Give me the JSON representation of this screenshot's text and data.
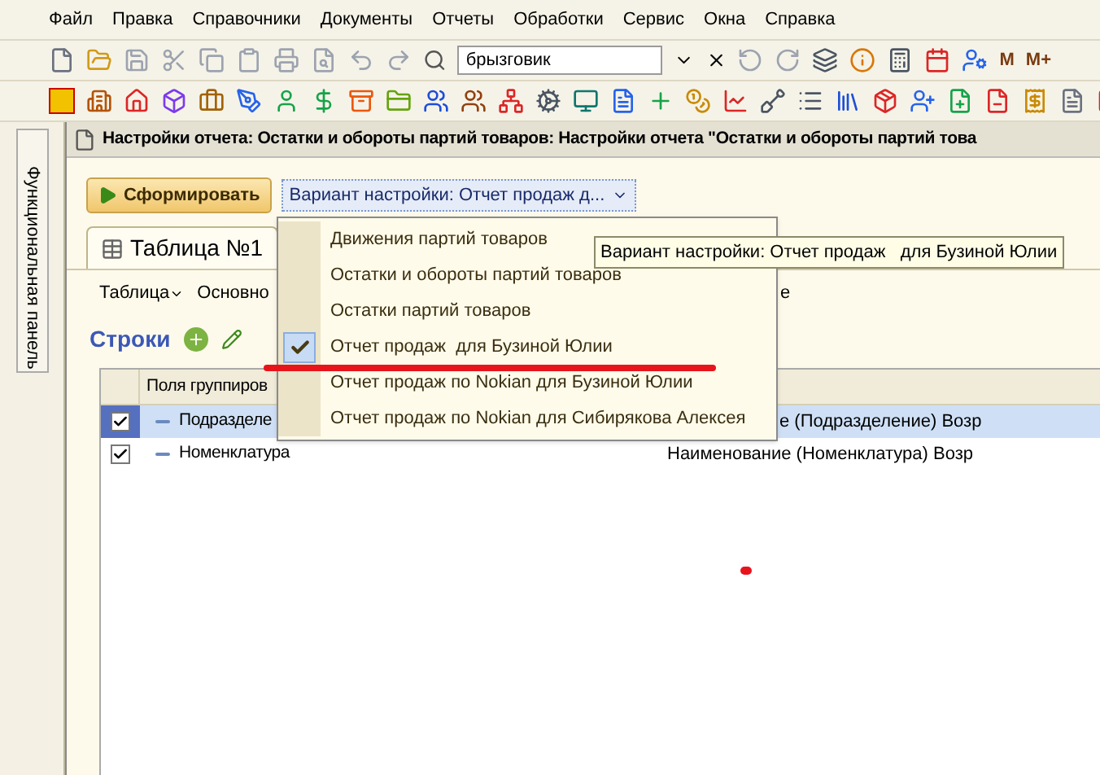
{
  "menu_bar": [
    {
      "label": "Файл"
    },
    {
      "label": "Правка"
    },
    {
      "label": "Справочники"
    },
    {
      "label": "Документы"
    },
    {
      "label": "Отчеты"
    },
    {
      "label": "Обработки"
    },
    {
      "label": "Сервис"
    },
    {
      "label": "Окна"
    },
    {
      "label": "Справка"
    }
  ],
  "toolbar": {
    "search": {
      "value": "брызговик"
    },
    "memory_buttons": [
      "M",
      "M+"
    ]
  },
  "side_panel": {
    "title": "Функциональная панель"
  },
  "window": {
    "title": "Настройки отчета: Остатки и обороты партий товаров: Настройки отчета \"Остатки и обороты партий това"
  },
  "generate_button": {
    "label": "Сформировать"
  },
  "variant_dropdown": {
    "value": "Вариант настройки: Отчет продаж  д...",
    "expanded": true
  },
  "tabs": [
    {
      "label": "Таблица №1",
      "selected": true
    }
  ],
  "table_toolbar": [
    {
      "kind": "menu",
      "label": "Таблица"
    },
    {
      "kind": "button",
      "label": "Основно"
    },
    {
      "kind": "button",
      "label": "е"
    }
  ],
  "rows_section": {
    "title": "Строки"
  },
  "grid": {
    "columns": [
      "Поля группиров"
    ],
    "rows": [
      {
        "checked": true,
        "selected": true,
        "field": "Подразделе",
        "column_2": "е (Подразделение) Возр"
      },
      {
        "checked": true,
        "selected": false,
        "field": "Номенклатура",
        "column_2": "Наименование (Номенклатура) Возр"
      }
    ]
  },
  "variant_menu": {
    "items": [
      {
        "label": "Движения партий товаров",
        "checked": false
      },
      {
        "label": "Остатки и обороты партий товаров",
        "checked": false
      },
      {
        "label": "Остатки партий товаров",
        "checked": false
      },
      {
        "label": "Отчет продаж  для Бузиной Юлии",
        "checked": true
      },
      {
        "label": "Отчет продаж по Nokian для Бузиной Юлии",
        "checked": false
      },
      {
        "label": "Отчет продаж по Nokian для Сибирякова Алексея",
        "checked": false
      }
    ]
  },
  "tooltip": {
    "text": "Вариант настройки: Отчет продаж   для Бузиной Юлии"
  }
}
